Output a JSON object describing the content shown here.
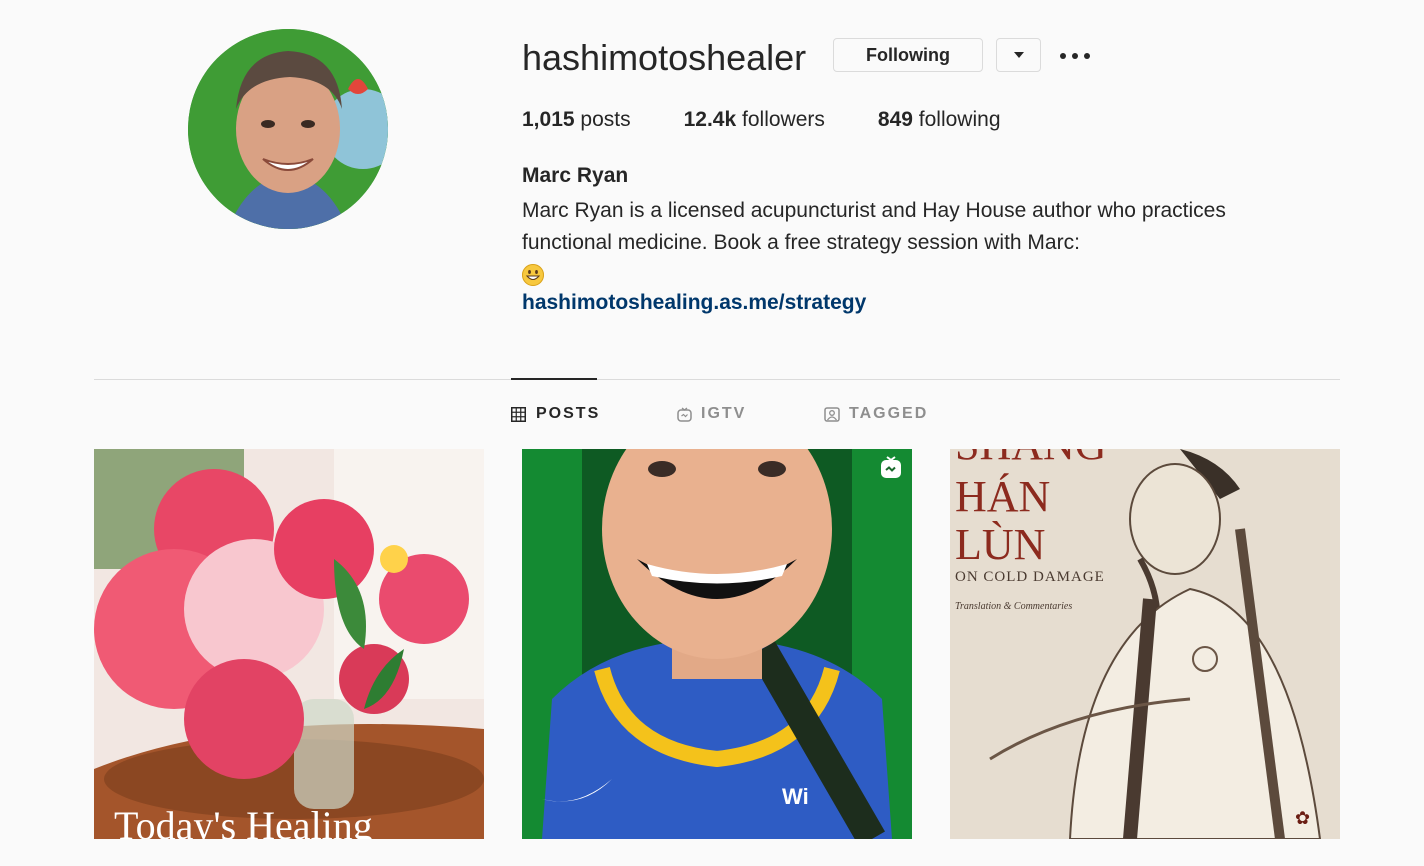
{
  "profile": {
    "username": "hashimotoshealer",
    "following_button": "Following",
    "stats": {
      "posts_count": "1,015",
      "posts_label": "posts",
      "followers_count": "12.4k",
      "followers_label": "followers",
      "following_count": "849",
      "following_label": "following"
    },
    "full_name": "Marc Ryan",
    "bio_line1": "Marc Ryan is a licensed acupuncturist and Hay House author who practices",
    "bio_line2": "functional medicine. Book a free strategy session with Marc:",
    "bio_emoji": "grinning-face",
    "link": "hashimotoshealing.as.me/strategy"
  },
  "tabs": [
    {
      "label": "POSTS",
      "icon": "grid-icon",
      "active": true
    },
    {
      "label": "IGTV",
      "icon": "igtv-icon",
      "active": false
    },
    {
      "label": "TAGGED",
      "icon": "tagged-icon",
      "active": false
    }
  ],
  "posts": [
    {
      "subject": "flowers-vase",
      "caption_text": "Today's Healing"
    },
    {
      "subject": "man-smiling-jersey",
      "badge": "igtv-icon"
    },
    {
      "subject": "book-cover",
      "book_title_line0": "SHANG",
      "book_title_line1": "HÁN",
      "book_title_line2": "LÙN",
      "book_subtitle": "ON COLD DAMAGE",
      "book_note": "Translation & Commentaries"
    }
  ],
  "colors": {
    "link": "#00376b",
    "text": "#262626",
    "border": "#dbdbdb",
    "muted": "#8e8e8e"
  }
}
